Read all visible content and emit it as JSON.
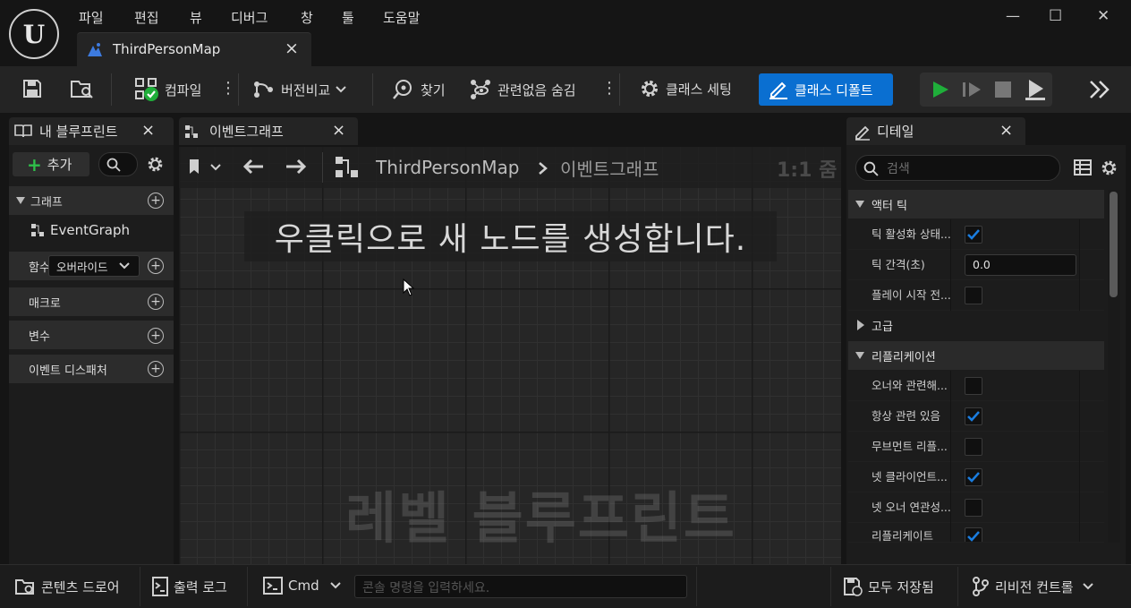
{
  "menu": [
    "파일",
    "편집",
    "뷰",
    "디버그",
    "창",
    "툴",
    "도움말"
  ],
  "document_tab": {
    "title": "ThirdPersonMap",
    "close": "×"
  },
  "window_controls": {
    "minimize": "—",
    "maximize": "☐",
    "close": "✕"
  },
  "toolbar": {
    "compile": "컴파일",
    "diff": "버전비교",
    "find": "찾기",
    "hide_unrelated": "관련없음 숨김",
    "class_settings": "클래스 세팅",
    "class_defaults": "클래스 디폴트"
  },
  "my_blueprint": {
    "tab_title": "내 블루프린트",
    "add_label": "추가",
    "sections": {
      "graphs": "그래프",
      "functions": "함수",
      "override": "오버라이드",
      "macros": "매크로",
      "variables": "변수",
      "dispatchers": "이벤트 디스패처"
    },
    "graph_items": [
      "EventGraph"
    ]
  },
  "graph": {
    "tab_title": "이벤트그래프",
    "breadcrumb_root": "ThirdPersonMap",
    "breadcrumb_current": "이벤트그래프",
    "zoom": "1:1 줌",
    "hint": "우클릭으로 새 노드를 생성합니다.",
    "watermark": "레벨 블루프린트"
  },
  "details": {
    "tab_title": "디테일",
    "search_placeholder": "검색",
    "sections": {
      "actor_tick": "액터 틱",
      "advanced": "고급",
      "replication": "리플리케이션"
    },
    "tick_rows": [
      {
        "label": "틱 활성화 상태...",
        "checked": true
      },
      {
        "label": "틱 간격(초)",
        "value": "0.0"
      },
      {
        "label": "플레이 시작 전...",
        "checked": false
      }
    ],
    "replication_rows": [
      {
        "label": "오너와 관련해...",
        "checked": false
      },
      {
        "label": "항상 관련 있음",
        "checked": true
      },
      {
        "label": "무브먼트 리플...",
        "checked": false
      },
      {
        "label": "넷 클라이언트...",
        "checked": true
      },
      {
        "label": "넷 오너 연관성...",
        "checked": false
      },
      {
        "label": "리플리케이트",
        "checked": true
      }
    ]
  },
  "statusbar": {
    "content_drawer": "콘텐츠 드로어",
    "output_log": "출력 로그",
    "cmd": "Cmd",
    "console_placeholder": "콘솔 명령을 입력하세요.",
    "save_all": "모두 저장됨",
    "revision_control": "리비전 컨트롤"
  },
  "colors": {
    "accent": "#0a6fd1",
    "play": "#1fae3a",
    "check": "#1a7de0"
  }
}
